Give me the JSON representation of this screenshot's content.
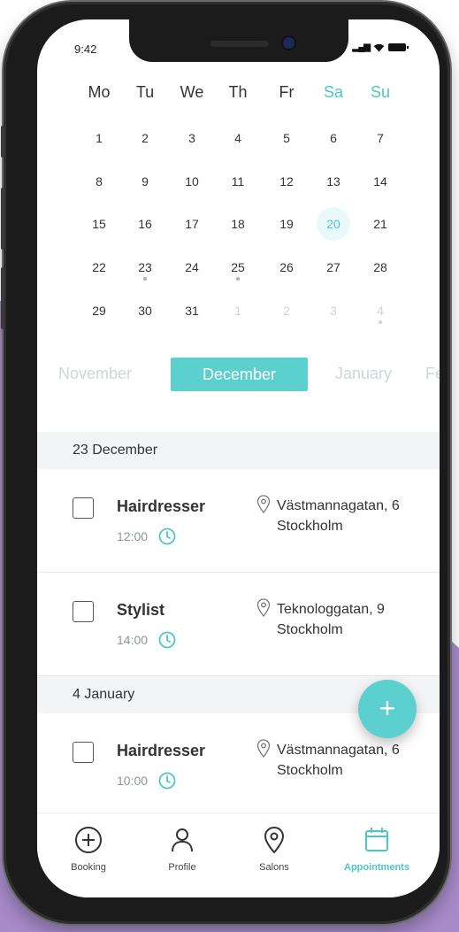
{
  "status": {
    "time": "9:42"
  },
  "calendar": {
    "weekdays": [
      "Mo",
      "Tu",
      "We",
      "Th",
      "Fr",
      "Sa",
      "Su"
    ],
    "weeks": [
      [
        "1",
        "2",
        "3",
        "4",
        "5",
        "6",
        "7"
      ],
      [
        "8",
        "9",
        "10",
        "11",
        "12",
        "13",
        "14"
      ],
      [
        "15",
        "16",
        "17",
        "18",
        "19",
        "20",
        "21"
      ],
      [
        "22",
        "23",
        "24",
        "25",
        "26",
        "27",
        "28"
      ],
      [
        "29",
        "30",
        "31",
        "1",
        "2",
        "3",
        "4"
      ]
    ],
    "selected_day": "20"
  },
  "months": {
    "prev": "November",
    "current": "December",
    "next": "January",
    "next2": "Fe"
  },
  "sections": [
    {
      "date": "23 December",
      "appointments": [
        {
          "service": "Hairdresser",
          "time": "12:00",
          "address_line1": "Västmannagatan, 6",
          "address_line2": "Stockholm"
        },
        {
          "service": "Stylist",
          "time": "14:00",
          "address_line1": "Teknologgatan, 9",
          "address_line2": "Stockholm"
        }
      ]
    },
    {
      "date": "4 January",
      "appointments": [
        {
          "service": "Hairdresser",
          "time": "10:00",
          "address_line1": "Västmannagatan, 6",
          "address_line2": "Stockholm"
        }
      ]
    }
  ],
  "fab": {
    "label": "+"
  },
  "tabs": [
    {
      "label": "Booking",
      "icon": "plus-circle-icon"
    },
    {
      "label": "Profile",
      "icon": "person-icon"
    },
    {
      "label": "Salons",
      "icon": "location-pin-icon"
    },
    {
      "label": "Appointments",
      "icon": "calendar-icon",
      "active": true
    }
  ],
  "colors": {
    "accent": "#5ccfcf",
    "background_purple": "#a78bc9"
  }
}
